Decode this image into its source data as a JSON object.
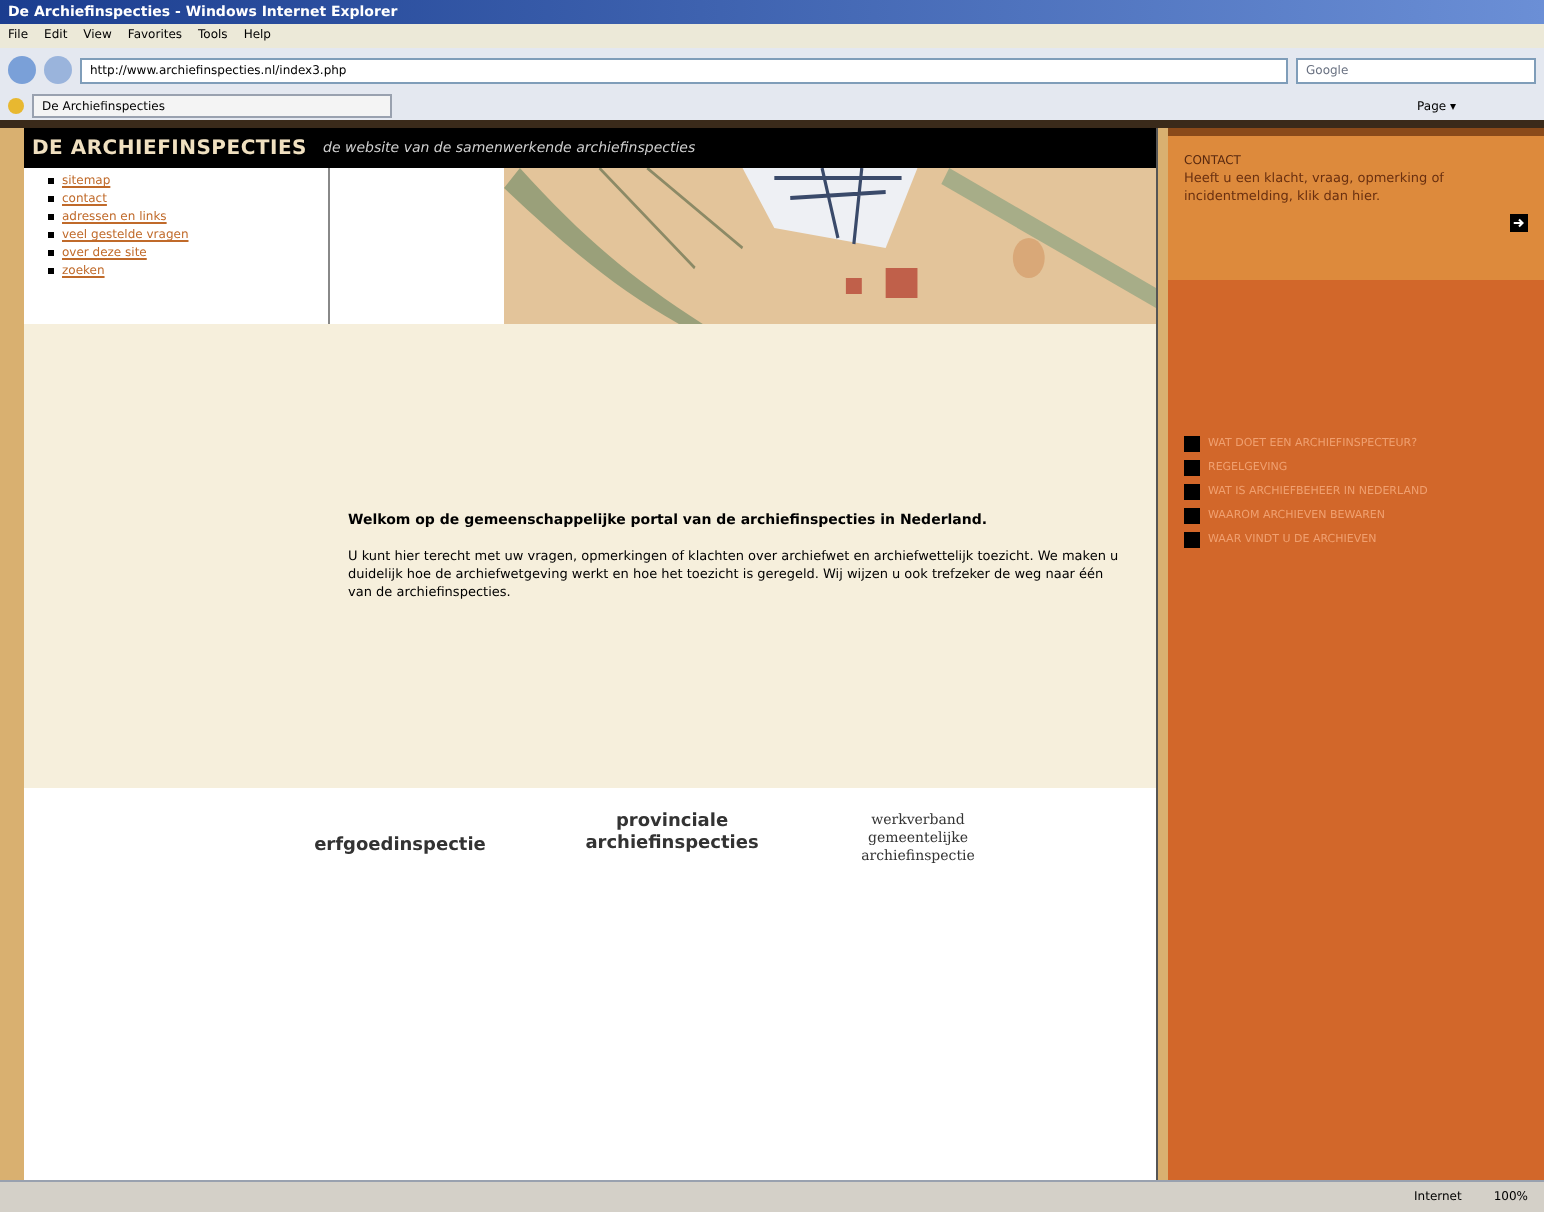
{
  "window": {
    "title": "De Archiefinspecties - Windows Internet Explorer"
  },
  "menu": [
    "File",
    "Edit",
    "View",
    "Favorites",
    "Tools",
    "Help"
  ],
  "address": {
    "value": "http://www.archiefinspecties.nl/index3.php"
  },
  "search": {
    "placeholder": "Google"
  },
  "tab": {
    "label": "De Archiefinspecties"
  },
  "toolbar": [
    "Page ▾"
  ],
  "site": {
    "title": "DE ARCHIEFINSPECTIES",
    "tagline": "de website van de samenwerkende archiefinspecties"
  },
  "nav": [
    "sitemap",
    "contact",
    "adressen en links",
    "veel gestelde vragen",
    "over deze site",
    "zoeken"
  ],
  "welcome": {
    "heading": "Welkom op de gemeenschappelijke portal van de archiefinspecties in Nederland.",
    "body": "U kunt hier terecht met uw vragen, opmerkingen of klachten over archiefwet en archiefwettelijk toezicht. We maken u duidelijk hoe de archiefwetgeving werkt en hoe het toezicht is geregeld. Wij wijzen u ook trefzeker de weg naar één van de archiefinspecties."
  },
  "logos": [
    {
      "kind": "sans",
      "text": "erfgoedinspectie"
    },
    {
      "kind": "sans",
      "text": "provinciale archiefinspecties"
    },
    {
      "kind": "serif",
      "text": "werkverband gemeentelijke archiefinspectie"
    }
  ],
  "contact": {
    "heading": "CONTACT",
    "text": "Heeft u een klacht, vraag, opmerking of incidentmelding, klik dan hier."
  },
  "links": [
    "WAT DOET EEN ARCHIEFINSPECTEUR?",
    "REGELGEVING",
    "WAT IS ARCHIEFBEHEER IN NEDERLAND",
    "WAAROM ARCHIEVEN BEWAREN",
    "WAAR VINDT U DE ARCHIEVEN"
  ],
  "status": {
    "zone": "Internet",
    "zoom": "100%"
  }
}
